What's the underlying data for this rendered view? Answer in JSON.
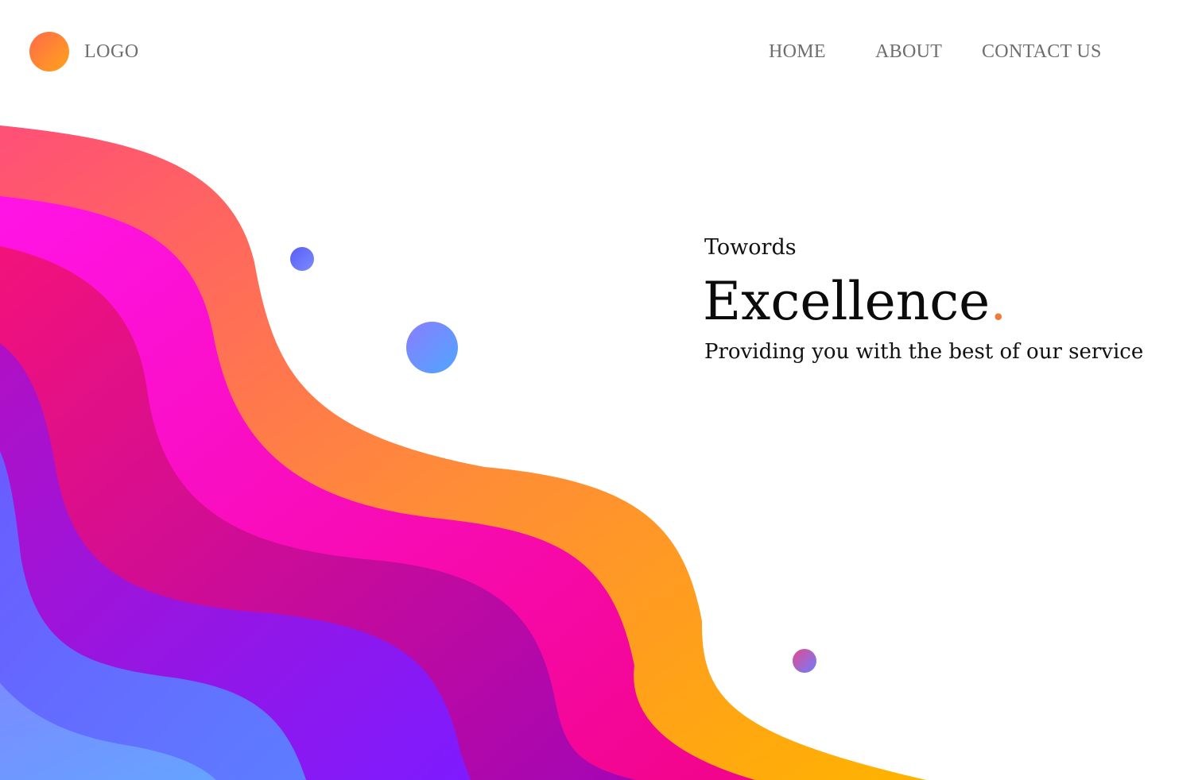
{
  "header": {
    "logo_text": "LOGO",
    "nav": [
      {
        "label": "HOME"
      },
      {
        "label": "ABOUT"
      },
      {
        "label": "CONTACT US"
      }
    ]
  },
  "hero": {
    "kicker": "Towords",
    "title": "Excellence",
    "title_accent": ".",
    "subtitle": "Providing you with the best of our service"
  },
  "colors": {
    "logo_gradient": [
      "#ff6a4a",
      "#ffa31a"
    ],
    "wave_bands": [
      "#ff5470",
      "#ff10d8",
      "#ec1385",
      "#a812c8",
      "#6b62ff",
      "#70a0ff"
    ],
    "accent_dot": "#f07a3c",
    "nav_text": "#6e6e6e"
  }
}
